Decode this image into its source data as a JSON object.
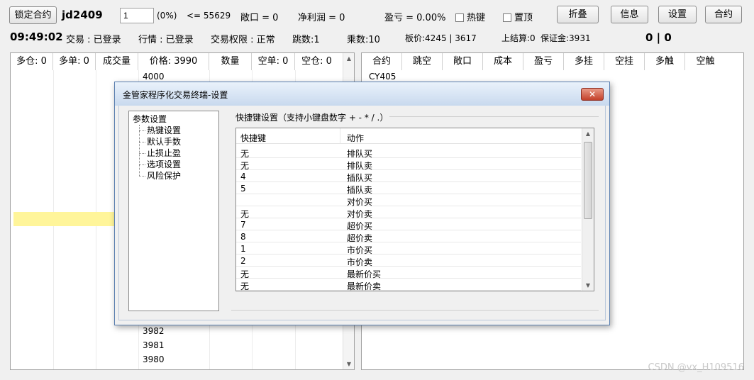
{
  "toolbar": {
    "lock_btn": "锁定合约",
    "contract": "jd2409",
    "qty_value": "1",
    "pct": "(0%)",
    "limit": "<= 55629",
    "open_pos": "敞口 = 0",
    "net_profit": "净利润 = 0",
    "pnl": "盈亏 = 0.00%",
    "hotkey_label": "热键",
    "pin_label": "置顶",
    "fold_btn": "折叠",
    "info_btn": "信息",
    "settings_btn": "设置",
    "contract_btn": "合约"
  },
  "status": {
    "time": "09:49:02",
    "trade": "交易 : 已登录",
    "quote": "行情 : 已登录",
    "permission": "交易权限 : 正常",
    "ticks": "跳数:1",
    "multiplier": "乘数:10",
    "board_price": "板价:4245 | 3617",
    "settle": "上结算:0",
    "margin": "保证金:3931",
    "score": "0 | 0"
  },
  "left_table": {
    "headers": [
      "多仓: 0",
      "多单: 0",
      "成交量",
      "价格: 3990",
      "数量",
      "空单: 0",
      "空仓: 0"
    ],
    "top_price": "4000",
    "bottom_prices": [
      "3982",
      "3981",
      "3980"
    ]
  },
  "right_table": {
    "headers": [
      "合约",
      "跳空",
      "敞口",
      "成本",
      "盈亏",
      "多挂",
      "空挂",
      "多触",
      "空触"
    ],
    "first_row": "CY405"
  },
  "dialog": {
    "title": "金管家程序化交易终端-设置",
    "close": "✕",
    "tree": {
      "root": "参数设置",
      "items": [
        "热键设置",
        "默认手数",
        "止损止盈",
        "选项设置",
        "风险保护"
      ]
    },
    "group_title": "快捷键设置（支持小键盘数字 + - * / .）",
    "list": {
      "headers": [
        "快捷键",
        "动作"
      ],
      "rows": [
        {
          "key": "无",
          "action": "排队买"
        },
        {
          "key": "无",
          "action": "排队卖"
        },
        {
          "key": "4",
          "action": "插队买"
        },
        {
          "key": "5",
          "action": "插队卖"
        },
        {
          "key": "",
          "action": "对价买"
        },
        {
          "key": "无",
          "action": "对价卖"
        },
        {
          "key": "7",
          "action": "超价买"
        },
        {
          "key": "8",
          "action": "超价卖"
        },
        {
          "key": "1",
          "action": "市价买"
        },
        {
          "key": "2",
          "action": "市价卖"
        },
        {
          "key": "无",
          "action": "最新价买"
        },
        {
          "key": "无",
          "action": "最新价卖"
        }
      ]
    }
  },
  "watermark": "CSDN @vx_H109516",
  "colors": {
    "highlight_row": "#fff59a",
    "dialog_title_bg": "#c8d9ee",
    "close_button": "#c3402a"
  }
}
